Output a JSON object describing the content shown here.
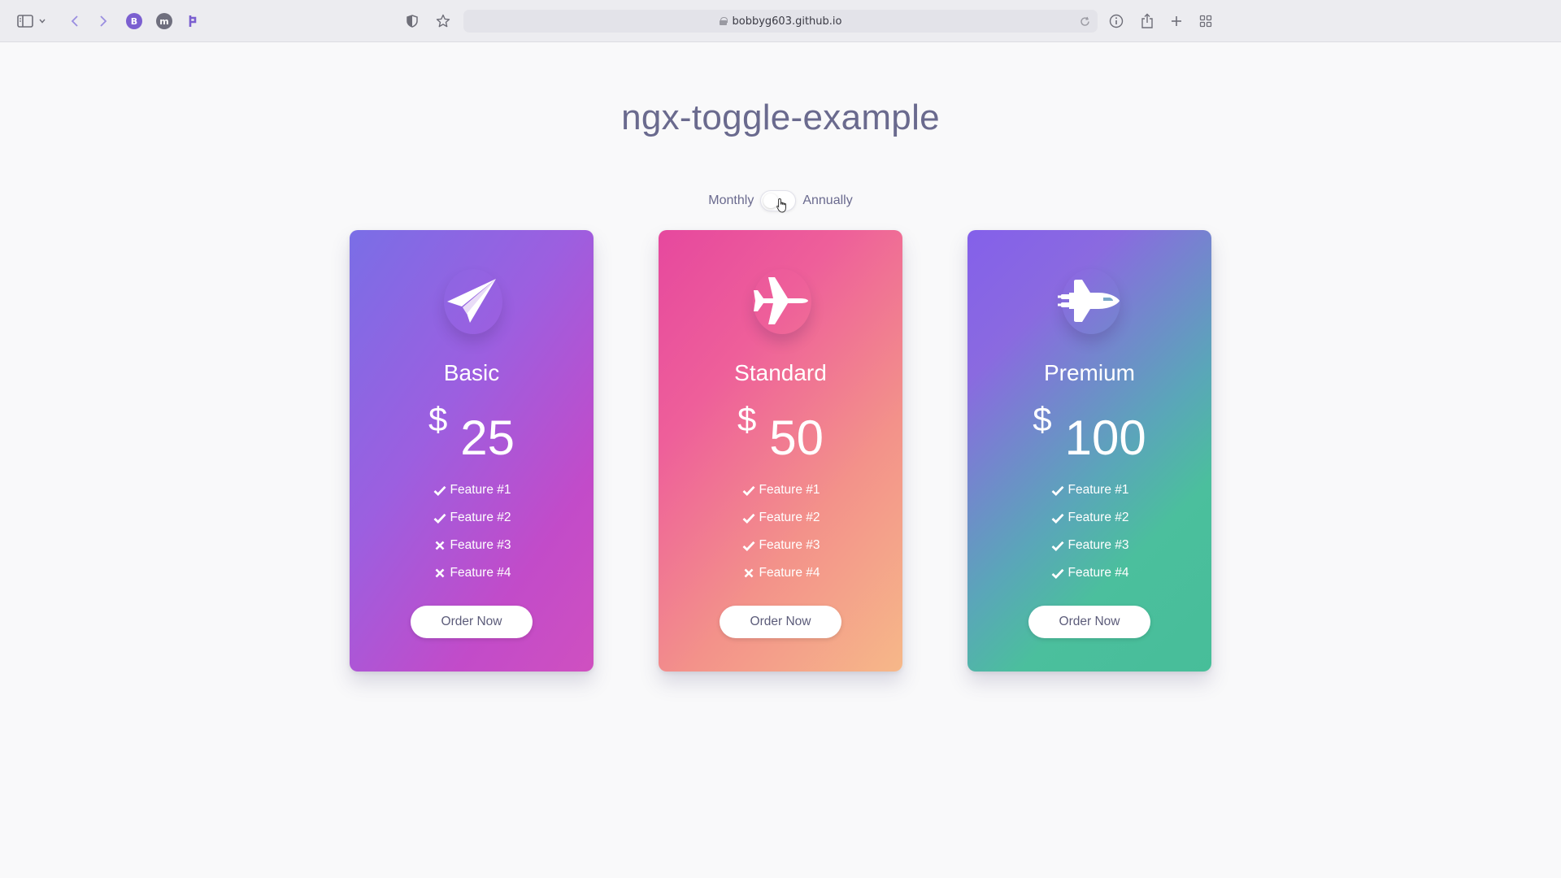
{
  "browser": {
    "url": "bobbyg603.github.io"
  },
  "page": {
    "title": "ngx-toggle-example",
    "toggle": {
      "left_label": "Monthly",
      "right_label": "Annually",
      "state": "monthly"
    }
  },
  "plans": [
    {
      "name": "Basic",
      "currency": "$",
      "price": "25",
      "icon": "paper-plane-icon",
      "features": [
        {
          "label": "Feature #1",
          "included": true
        },
        {
          "label": "Feature #2",
          "included": true
        },
        {
          "label": "Feature #3",
          "included": false
        },
        {
          "label": "Feature #4",
          "included": false
        }
      ],
      "cta": "Order Now"
    },
    {
      "name": "Standard",
      "currency": "$",
      "price": "50",
      "icon": "plane-icon",
      "features": [
        {
          "label": "Feature #1",
          "included": true
        },
        {
          "label": "Feature #2",
          "included": true
        },
        {
          "label": "Feature #3",
          "included": true
        },
        {
          "label": "Feature #4",
          "included": false
        }
      ],
      "cta": "Order Now"
    },
    {
      "name": "Premium",
      "currency": "$",
      "price": "100",
      "icon": "space-shuttle-icon",
      "features": [
        {
          "label": "Feature #1",
          "included": true
        },
        {
          "label": "Feature #2",
          "included": true
        },
        {
          "label": "Feature #3",
          "included": true
        },
        {
          "label": "Feature #4",
          "included": true
        }
      ],
      "cta": "Order Now"
    }
  ],
  "colors": {
    "title_text": "#6a6a8e",
    "basic_gradient": [
      "#7a6ee6",
      "#cf50c0"
    ],
    "standard_gradient": [
      "#e6489e",
      "#f6b889"
    ],
    "premium_gradient": [
      "#8460ea",
      "#47be99"
    ]
  }
}
